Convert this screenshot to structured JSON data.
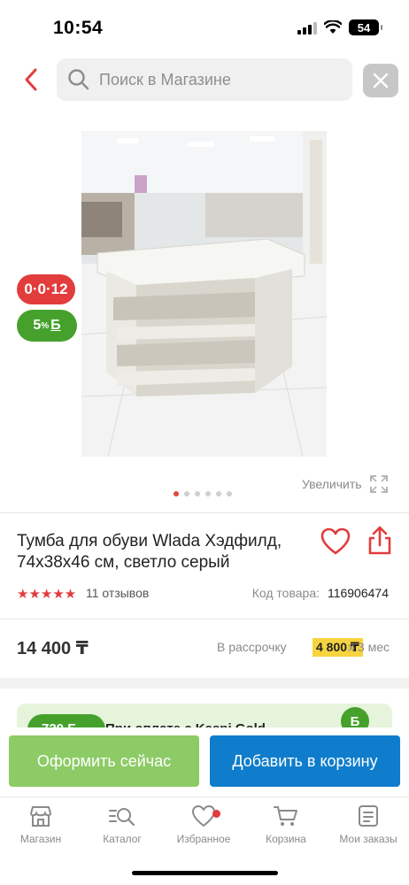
{
  "status_bar": {
    "time": "10:54",
    "battery": "54"
  },
  "search": {
    "placeholder": "Поиск в Магазине"
  },
  "badges": {
    "installment": "0·0·12",
    "bonus_percent": "5",
    "bonus_symbol": "%",
    "bonus_currency": "Б"
  },
  "gallery": {
    "zoom_label": "Увеличить",
    "image_count": 6,
    "active_index": 0
  },
  "product": {
    "title": "Тумба для обуви Wlada Хэдфилд, 74х38х46 см, светло серый",
    "reviews_label": "11 отзывов",
    "rating": 5,
    "code_label": "Код товара:",
    "code_value": "116906474",
    "price": "14 400 ₸",
    "installment_label": "В рассрочку",
    "installment_amount": "4 800 ₸",
    "installment_term": "х 3 мес"
  },
  "promo": {
    "badge": "720 Б",
    "text": "При оплате с Kaspi Gold",
    "coin": "Б"
  },
  "actions": {
    "checkout_label": "Оформить сейчас",
    "add_to_cart_label": "Добавить в корзину"
  },
  "tabs": [
    {
      "label": "Магазин",
      "icon": "store-icon"
    },
    {
      "label": "Каталог",
      "icon": "catalog-search-icon"
    },
    {
      "label": "Избранное",
      "icon": "heart-icon"
    },
    {
      "label": "Корзина",
      "icon": "cart-icon"
    },
    {
      "label": "Мои заказы",
      "icon": "orders-icon"
    }
  ],
  "colors": {
    "accent_red": "#e23c3c",
    "bonus_green": "#45a12c",
    "checkout_green": "#8dcb66",
    "cart_blue": "#0f7dcb",
    "installment_yellow": "#f7d43f"
  }
}
